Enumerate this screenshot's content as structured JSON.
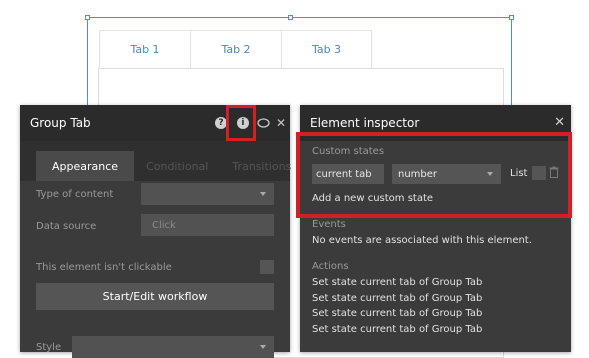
{
  "canvas": {
    "tabs": [
      "Tab 1",
      "Tab 2",
      "Tab 3"
    ]
  },
  "group_tab_panel": {
    "title": "Group Tab",
    "header_icons": [
      "help-icon",
      "info-icon",
      "comment-icon",
      "close-icon"
    ],
    "tabs": [
      "Appearance",
      "Conditional",
      "Transitions"
    ],
    "type_of_content_label": "Type of content",
    "data_source_label": "Data source",
    "data_source_value": "Click",
    "not_clickable_label": "This element isn't clickable",
    "workflow_button": "Start/Edit workflow",
    "style_label": "Style"
  },
  "inspector": {
    "title": "Element inspector",
    "close": "✕",
    "custom_states_label": "Custom states",
    "state_name": "current tab",
    "state_type": "number",
    "list_label": "List",
    "add_state": "Add a new custom state",
    "events_label": "Events",
    "events_text": "No events are associated with this element.",
    "actions_label": "Actions",
    "actions": [
      "Set state current tab of Group Tab",
      "Set state current tab of Group Tab",
      "Set state current tab of Group Tab",
      "Set state current tab of Group Tab"
    ]
  },
  "colors": {
    "highlight": "#d22027",
    "selection": "#4a90d9",
    "tab_text": "#4a86c5"
  }
}
